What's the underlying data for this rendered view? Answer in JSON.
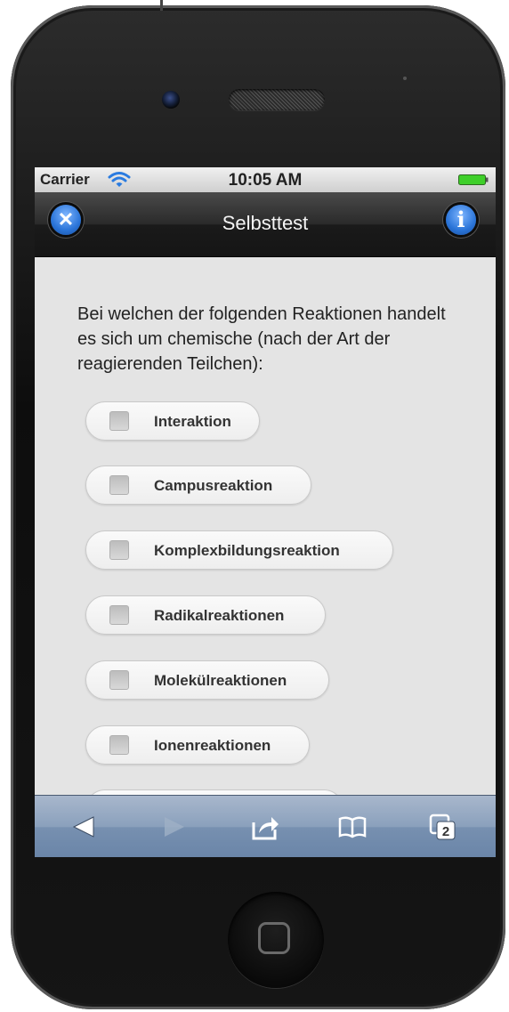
{
  "status_bar": {
    "carrier": "Carrier",
    "time": "10:05 AM",
    "icons": [
      "wifi-icon",
      "battery-icon"
    ]
  },
  "nav_bar": {
    "title": "Selbsttest",
    "left_button_icon": "close-icon",
    "right_button_icon": "info-icon",
    "close_glyph": "✕",
    "info_glyph": "i"
  },
  "question": {
    "text": "Bei welchen der folgenden Reaktionen handelt es sich um chemische (nach der Art der reagierenden Teilchen):"
  },
  "options": [
    {
      "label": "Interaktion",
      "checked": false
    },
    {
      "label": "Campusreaktion",
      "checked": false
    },
    {
      "label": "Komplexbildungsreaktion",
      "checked": false
    },
    {
      "label": "Radikalreaktionen",
      "checked": false
    },
    {
      "label": "Molekülreaktionen",
      "checked": false
    },
    {
      "label": "Ionenreaktionen",
      "checked": false
    }
  ],
  "toolbar": {
    "items": [
      "back-arrow-icon",
      "forward-arrow-icon",
      "share-icon",
      "bookmarks-icon",
      "tabs-icon"
    ],
    "tabs_count": "2"
  },
  "colors": {
    "accent": "#2a74d8",
    "toolbar": "#8aa0bc",
    "battery": "#3fcf2a"
  }
}
